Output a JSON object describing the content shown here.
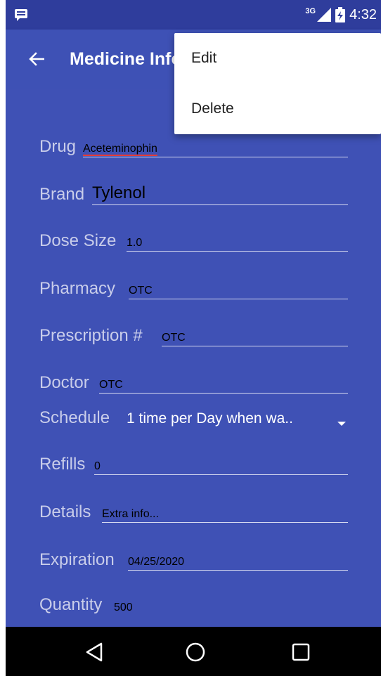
{
  "status_bar": {
    "network": "3G",
    "time": "4:32"
  },
  "app_bar": {
    "title": "Medicine Info"
  },
  "menu": {
    "items": [
      {
        "label": "Edit"
      },
      {
        "label": "Delete"
      }
    ]
  },
  "fields": {
    "drug": {
      "label": "Drug",
      "value": "Aceteminophin"
    },
    "brand": {
      "label": "Brand",
      "value": "Tylenol"
    },
    "dose": {
      "label": "Dose Size",
      "value": "1.0"
    },
    "pharmacy": {
      "label": "Pharmacy",
      "value": "OTC"
    },
    "prescription": {
      "label": "Prescription #",
      "value": "OTC"
    },
    "doctor": {
      "label": "Doctor",
      "value": "OTC"
    },
    "schedule": {
      "label": "Schedule",
      "value": "1 time per Day when wa.."
    },
    "refills": {
      "label": "Refills",
      "value": "0"
    },
    "details": {
      "label": "Details",
      "placeholder": "Extra info..."
    },
    "expiration": {
      "label": "Expiration",
      "value": "04/25/2020"
    },
    "quantity": {
      "label": "Quantity",
      "value": "500"
    }
  },
  "icons": {
    "notification": "notification-icon",
    "signal": "signal-icon",
    "battery": "battery-icon",
    "back": "back-arrow-icon",
    "nav_back": "nav-back-icon",
    "nav_home": "nav-home-icon",
    "nav_recents": "nav-recents-icon"
  },
  "colors": {
    "primary": "#3f51b5",
    "primary_dark": "#2f3d9c",
    "spell_error": "#e53935"
  }
}
